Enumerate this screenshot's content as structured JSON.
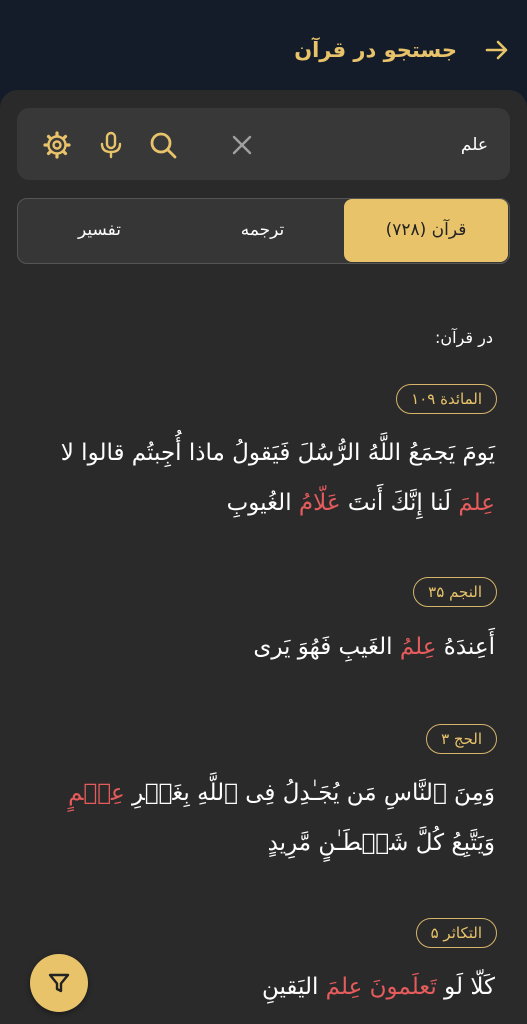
{
  "header": {
    "title": "جستجو در قرآن"
  },
  "search": {
    "value": "علم"
  },
  "tabs": [
    {
      "label": "قرآن (۷۲۸)",
      "active": true
    },
    {
      "label": "ترجمه",
      "active": false
    },
    {
      "label": "تفسیر",
      "active": false
    }
  ],
  "results": {
    "section_label": "در قرآن:",
    "items": [
      {
        "ref": "المائدة ۱۰۹",
        "segments": [
          "يَومَ يَجمَعُ اللَّهُ الرُّسُلَ فَيَقولُ ماذا أُجِبتُم قالوا لا ",
          "عِلمَ",
          " لَنا إِنَّكَ أَنتَ ",
          "عَلّامُ",
          " الغُيوبِ"
        ]
      },
      {
        "ref": "النجم ۳۵",
        "segments": [
          "أَعِندَهُ ",
          "عِلمُ",
          " الغَيبِ فَهُوَ يَرى"
        ]
      },
      {
        "ref": "الحج ۳",
        "segments": [
          "وَمِنَ ٱلنَّاسِ مَن يُجَـٰدِلُ فِى ٱللَّهِ بِغَيۡرِ ",
          "عِلۡمٍ",
          " وَيَتَّبِعُ كُلَّ شَيۡطَـٰنٍ مَّرِيدٍ"
        ]
      },
      {
        "ref": "التكاثر ۵",
        "segments": [
          "كَلّا لَو ",
          "تَعلَمونَ عِلمَ",
          " اليَقينِ"
        ]
      }
    ]
  },
  "colors": {
    "accent": "#e8c36a",
    "highlight": "#e65b5b",
    "background": "#141c29",
    "sheet": "#2a2a2b"
  }
}
